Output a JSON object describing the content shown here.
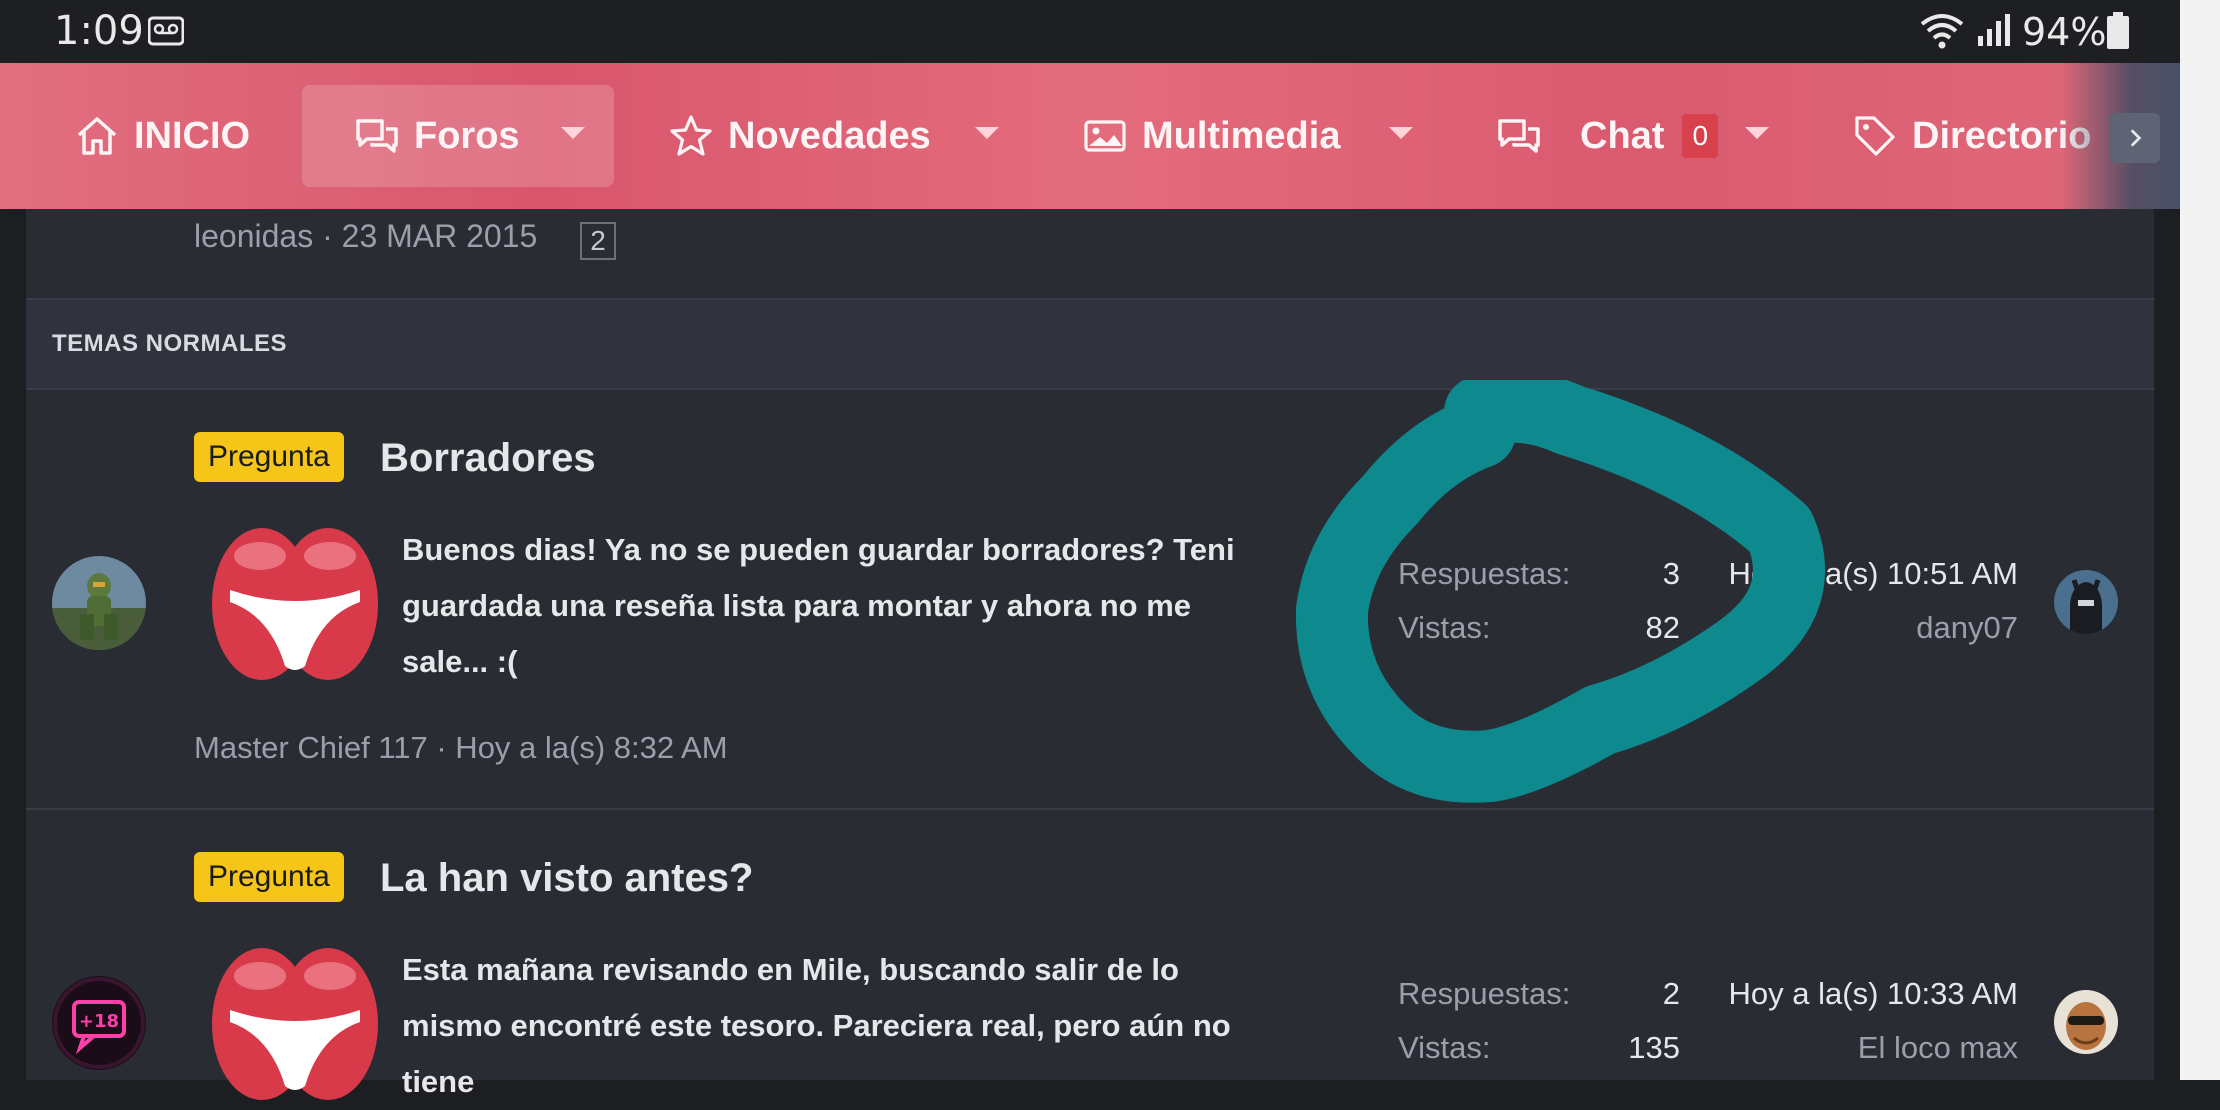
{
  "status_bar": {
    "time": "1:09",
    "battery_percent": "94%",
    "icons": [
      "voicemail-icon",
      "wifi-icon",
      "signal-icon",
      "battery-icon"
    ]
  },
  "nav": {
    "items": [
      {
        "label": "INICIO",
        "icon": "home-icon"
      },
      {
        "label": "Foros",
        "icon": "chat-bubbles-icon",
        "active": true
      },
      {
        "label": "Novedades",
        "icon": "star-icon"
      },
      {
        "label": "Multimedia",
        "icon": "image-icon"
      },
      {
        "label": "Chat",
        "icon": "chat-bubbles-icon",
        "badge": "0"
      },
      {
        "label": "Directorio",
        "icon": "tag-icon"
      }
    ]
  },
  "previous_thread": {
    "meta": "leonidas · 23 MAR 2015",
    "page": "2"
  },
  "section": {
    "title": "TEMAS NORMALES"
  },
  "threads": [
    {
      "prefix": "Pregunta",
      "title": "Borradores",
      "snippet_lines": [
        "Buenos dias! Ya no se pueden guardar borradores? Teni",
        "guardada una reseña lista para montar y ahora no me",
        "sale... :("
      ],
      "starter_meta": "Master Chief 117 · Hoy a la(s) 8:32 AM",
      "replies_label": "Respuestas:",
      "replies": "3",
      "views_label": "Vistas:",
      "views": "82",
      "last_post_time": "Hoy a la(s) 10:51 AM",
      "last_post_user": "dany07"
    },
    {
      "prefix": "Pregunta",
      "title": "La han visto antes?",
      "snippet_lines": [
        "Esta mañana revisando en Mile, buscando salir de lo",
        "mismo encontré este tesoro. Pareciera real, pero aún no",
        "tiene"
      ],
      "replies_label": "Respuestas:",
      "replies": "2",
      "views_label": "Vistas:",
      "views": "135",
      "last_post_time": "Hoy a la(s) 10:33 AM",
      "last_post_user": "El loco max"
    }
  ],
  "colors": {
    "nav_pink": "#d9566c",
    "prefix_yellow": "#f5c518",
    "panel": "#2a2c34",
    "annotation_teal": "#0e8a8f"
  }
}
